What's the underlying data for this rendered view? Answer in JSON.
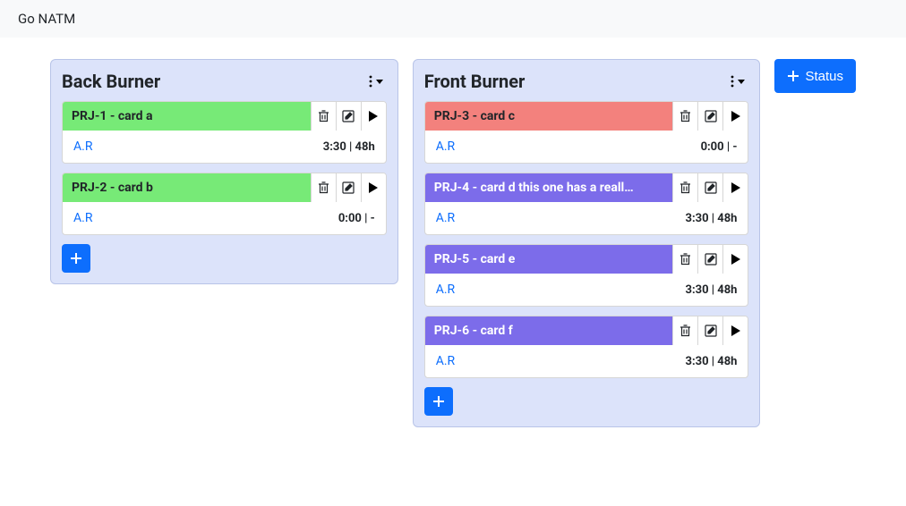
{
  "app": {
    "title": "Go NATM"
  },
  "status_button": {
    "label": "Status"
  },
  "colors": {
    "green": "#77ea77",
    "red": "#f3817d",
    "purple": "#7c6cea",
    "primary": "#0d6efd"
  },
  "columns": [
    {
      "title": "Back Burner",
      "cards": [
        {
          "title": "PRJ-1 - card a",
          "color": "green",
          "assignee": "A.R",
          "time": "3:30 | 48h"
        },
        {
          "title": "PRJ-2 - card b",
          "color": "green",
          "assignee": "A.R",
          "time": "0:00 | -"
        }
      ]
    },
    {
      "title": "Front Burner",
      "cards": [
        {
          "title": "PRJ-3 - card c",
          "color": "red",
          "assignee": "A.R",
          "time": "0:00 | -"
        },
        {
          "title": "PRJ-4 - card d this one has a reall…",
          "color": "purple",
          "assignee": "A.R",
          "time": "3:30 | 48h"
        },
        {
          "title": "PRJ-5 - card e",
          "color": "purple",
          "assignee": "A.R",
          "time": "3:30 | 48h"
        },
        {
          "title": "PRJ-6 - card f",
          "color": "purple",
          "assignee": "A.R",
          "time": "3:30 | 48h"
        }
      ]
    }
  ]
}
